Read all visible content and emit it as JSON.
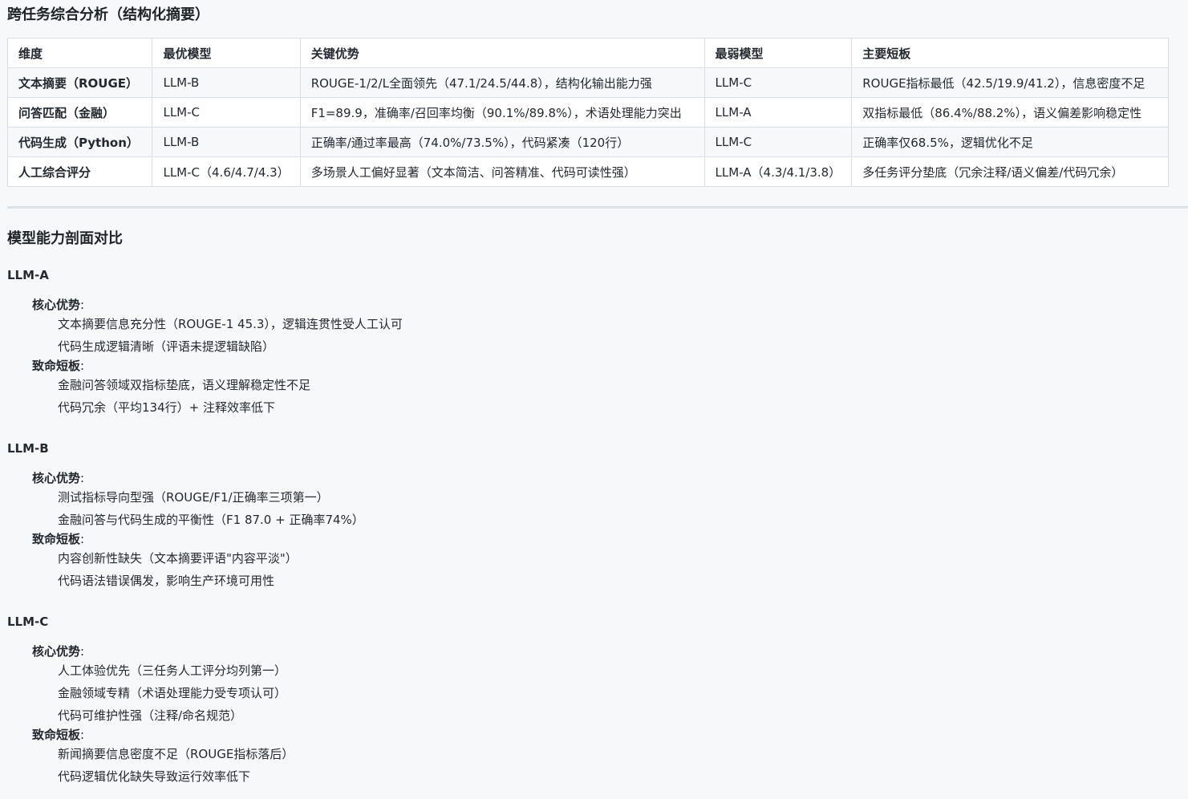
{
  "summary": {
    "title": "跨任务综合分析（结构化摘要）",
    "headers": [
      "维度",
      "最优模型",
      "关键优势",
      "最弱模型",
      "主要短板"
    ],
    "rows": [
      [
        "文本摘要（ROUGE）",
        "LLM-B",
        "ROUGE-1/2/L全面领先（47.1/24.5/44.8），结构化输出能力强",
        "LLM-C",
        "ROUGE指标最低（42.5/19.9/41.2），信息密度不足"
      ],
      [
        "问答匹配（金融）",
        "LLM-C",
        "F1=89.9，准确率/召回率均衡（90.1%/89.8%），术语处理能力突出",
        "LLM-A",
        "双指标最低（86.4%/88.2%），语义偏差影响稳定性"
      ],
      [
        "代码生成（Python）",
        "LLM-B",
        "正确率/通过率最高（74.0%/73.5%），代码紧凑（120行）",
        "LLM-C",
        "正确率仅68.5%，逻辑优化不足"
      ],
      [
        "人工综合评分",
        "LLM-C（4.6/4.7/4.3）",
        "多场景人工偏好显著（文本简洁、问答精准、代码可读性强）",
        "LLM-A（4.3/4.1/3.8）",
        "多任务评分垫底（冗余注释/语义偏差/代码冗余）"
      ]
    ]
  },
  "profiles": {
    "title": "模型能力剖面对比",
    "strength_label": "核心优势",
    "weakness_label": "致命短板",
    "colon": ":",
    "models": [
      {
        "name": "LLM-A",
        "strengths": [
          "文本摘要信息充分性（ROUGE-1 45.3），逻辑连贯性受人工认可",
          "代码生成逻辑清晰（评语未提逻辑缺陷）"
        ],
        "weaknesses": [
          "金融问答领域双指标垫底，语义理解稳定性不足",
          "代码冗余（平均134行）+ 注释效率低下"
        ]
      },
      {
        "name": "LLM-B",
        "strengths": [
          "测试指标导向型强（ROUGE/F1/正确率三项第一）",
          "金融问答与代码生成的平衡性（F1 87.0 + 正确率74%）"
        ],
        "weaknesses": [
          "内容创新性缺失（文本摘要评语\"内容平淡\"）",
          "代码语法错误偶发，影响生产环境可用性"
        ]
      },
      {
        "name": "LLM-C",
        "strengths": [
          "人工体验优先（三任务人工评分均列第一）",
          "金融领域专精（术语处理能力受专项认可）",
          "代码可维护性强（注释/命名规范）"
        ],
        "weaknesses": [
          "新闻摘要信息密度不足（ROUGE指标落后）",
          "代码逻辑优化缺失导致运行效率低下"
        ]
      }
    ]
  }
}
